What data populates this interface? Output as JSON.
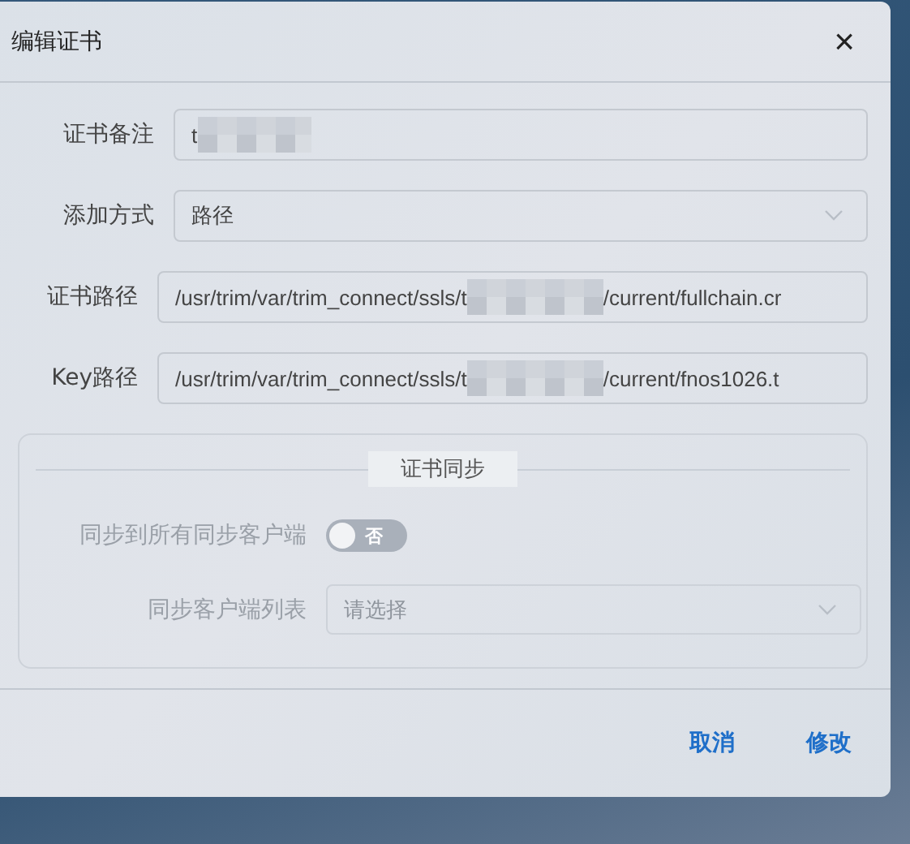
{
  "dialog": {
    "title": "编辑证书",
    "close": "×"
  },
  "fields": [
    {
      "kind": "text",
      "label": "证书备注",
      "value_start": "t",
      "redacted": true
    },
    {
      "kind": "select",
      "label": "添加方式",
      "value": "路径"
    },
    {
      "kind": "text",
      "label": "证书路径",
      "value_start": "/usr/trim/var/trim_connect/ssls/t",
      "redacted": true,
      "value_end": "/current/fullchain.cr"
    },
    {
      "kind": "text",
      "label": "Key路径",
      "value_start": "/usr/trim/var/trim_connect/ssls/t",
      "redacted": true,
      "value_end": "/current/fnos1026.t"
    }
  ],
  "sync_section": {
    "legend": "证书同步",
    "sync_all": {
      "label": "同步到所有同步客户端",
      "on": false,
      "state_text": "否",
      "disabled": true
    },
    "client_list": {
      "label": "同步客户端列表",
      "placeholder": "请选择",
      "disabled": true
    }
  },
  "buttons": [
    {
      "label": "取消"
    },
    {
      "label": "修改"
    }
  ]
}
